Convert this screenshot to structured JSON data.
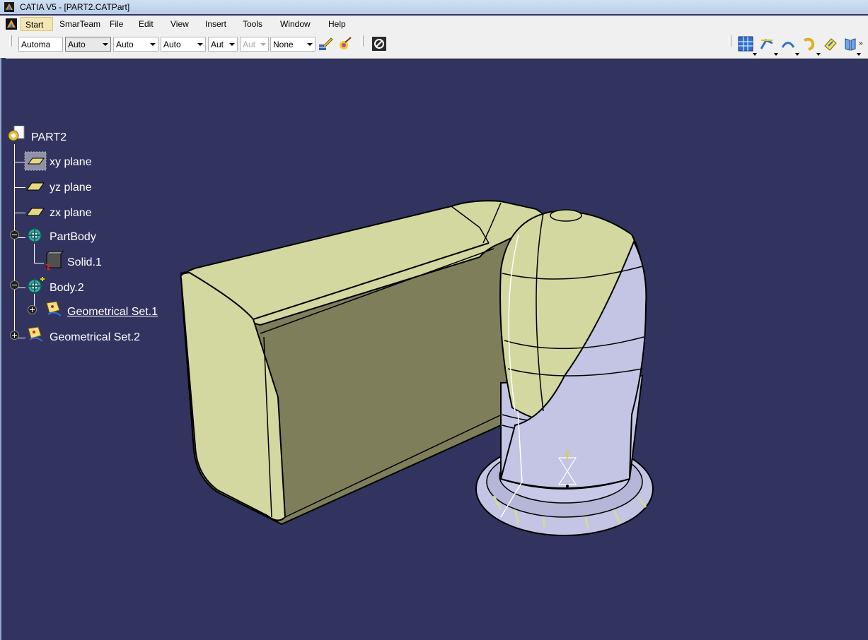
{
  "window": {
    "title": "CATIA V5 - [PART2.CATPart]"
  },
  "menu": {
    "items": [
      "Start",
      "SmarTeam",
      "File",
      "Edit",
      "View",
      "Insert",
      "Tools",
      "Window",
      "Help"
    ]
  },
  "toolbar": {
    "combos": [
      {
        "value": "Automa",
        "state": "normal"
      },
      {
        "value": "Auto",
        "state": "selected"
      },
      {
        "value": "Auto",
        "state": "normal"
      },
      {
        "value": "Auto",
        "state": "normal"
      },
      {
        "value": "Aut",
        "state": "normal"
      },
      {
        "value": "Aut",
        "state": "disabled"
      },
      {
        "value": "None",
        "state": "normal"
      }
    ],
    "icons_left": [
      "painter-brush-icon",
      "apply-material-icon",
      "no-show-icon"
    ],
    "icons_right": [
      "view-grid-icon",
      "sketch-tools-icon",
      "arc-icon",
      "curve-icon",
      "surface-icon",
      "split-icon"
    ]
  },
  "tree": {
    "root": "PART2",
    "nodes": [
      {
        "label": "xy plane",
        "icon": "plane-icon",
        "underlined": false
      },
      {
        "label": "yz plane",
        "icon": "plane-icon",
        "underlined": false
      },
      {
        "label": "zx plane",
        "icon": "plane-icon",
        "underlined": false
      },
      {
        "label": "PartBody",
        "icon": "body-icon",
        "underlined": false
      },
      {
        "label": "Solid.1",
        "icon": "solid-icon",
        "underlined": false
      },
      {
        "label": "Body.2",
        "icon": "body-icon",
        "underlined": false
      },
      {
        "label": "Geometrical Set.1",
        "icon": "geometrical-set-icon",
        "underlined": true
      },
      {
        "label": "Geometrical Set.2",
        "icon": "geometrical-set-icon",
        "underlined": false
      }
    ]
  },
  "colors": {
    "viewport_bg": "#33335f",
    "solid_fill": "#d3d8a0",
    "solid_shade": "#7e7f5a",
    "surface_fill": "#c4c4e4"
  }
}
